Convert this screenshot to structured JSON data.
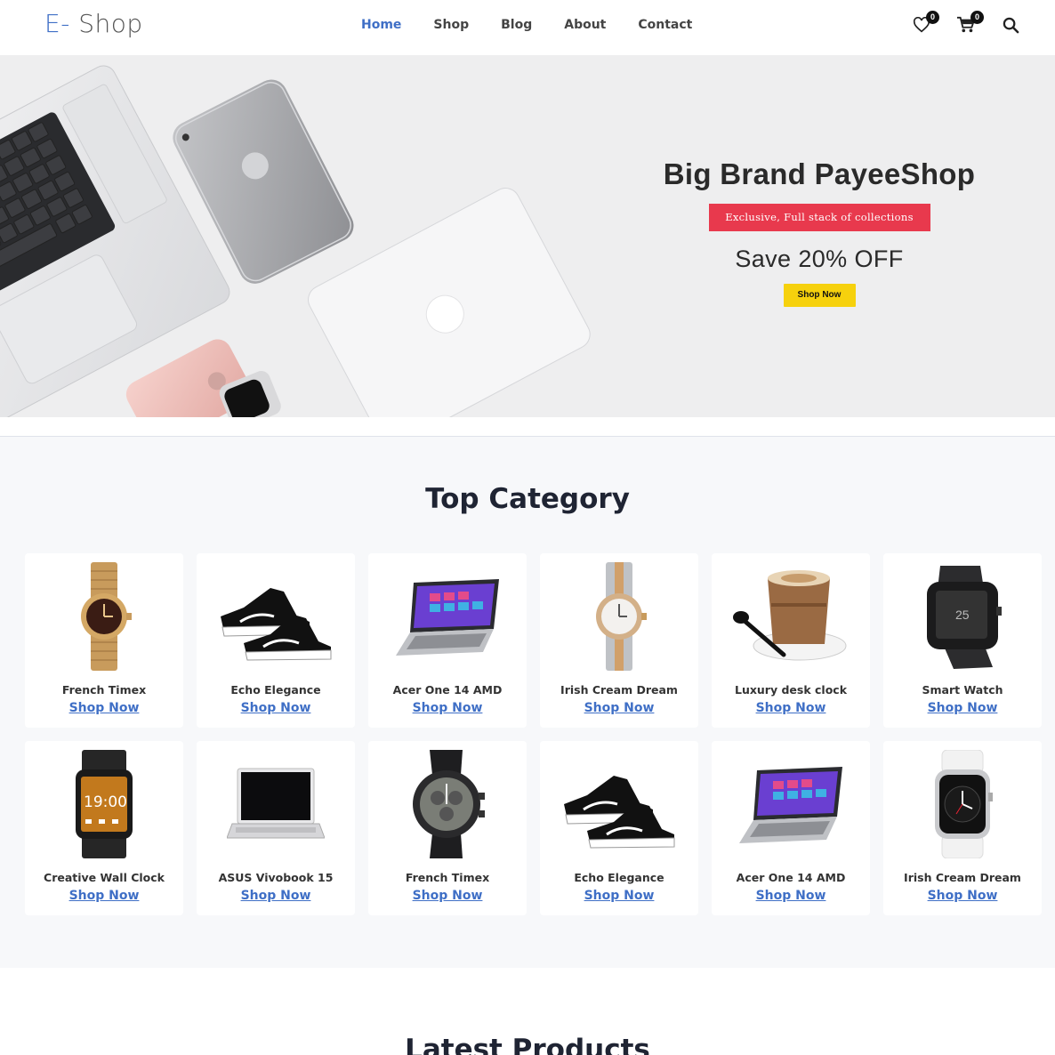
{
  "brand": {
    "prefix": "E-",
    "name": " Shop",
    "accent": "#3f6fc6"
  },
  "nav": {
    "items": [
      {
        "label": "Home",
        "active": true
      },
      {
        "label": "Shop",
        "active": false
      },
      {
        "label": "Blog",
        "active": false
      },
      {
        "label": "About",
        "active": false
      },
      {
        "label": "Contact",
        "active": false
      }
    ],
    "wishlist_count": "0",
    "cart_count": "0",
    "icons": [
      "heart-icon",
      "cart-icon",
      "search-icon"
    ]
  },
  "hero": {
    "title": "Big Brand PayeeShop",
    "tagline": "Exclusive, Full stack of collections",
    "offer": "Save 20% OFF",
    "button": "Shop Now",
    "colors": {
      "tagline_bg": "#e8394d",
      "button_bg": "#f6d10d",
      "background": "#eeeeef"
    }
  },
  "top_category": {
    "title": "Top Category",
    "items": [
      {
        "name": "French Timex",
        "link": "Shop Now",
        "image": "gold-watch"
      },
      {
        "name": "Echo Elegance",
        "link": "Shop Now",
        "image": "sneakers"
      },
      {
        "name": "Acer One 14 AMD",
        "link": "Shop Now",
        "image": "laptop"
      },
      {
        "name": "Irish Cream Dream",
        "link": "Shop Now",
        "image": "silver-watch"
      },
      {
        "name": "Luxury desk clock",
        "link": "Shop Now",
        "image": "coffee-cup"
      },
      {
        "name": "Smart Watch",
        "link": "Shop Now",
        "image": "smart-watch"
      },
      {
        "name": "Creative Wall Clock",
        "link": "Shop Now",
        "image": "smart-watch-orange",
        "time": "19:00"
      },
      {
        "name": "ASUS Vivobook 15",
        "link": "Shop Now",
        "image": "laptop-black"
      },
      {
        "name": "French Timex",
        "link": "Shop Now",
        "image": "chrono-watch"
      },
      {
        "name": "Echo Elegance",
        "link": "Shop Now",
        "image": "sneakers"
      },
      {
        "name": "Acer One 14 AMD",
        "link": "Shop Now",
        "image": "laptop"
      },
      {
        "name": "Irish Cream Dream",
        "link": "Shop Now",
        "image": "apple-watch"
      }
    ]
  },
  "latest": {
    "title": "Latest Products"
  }
}
